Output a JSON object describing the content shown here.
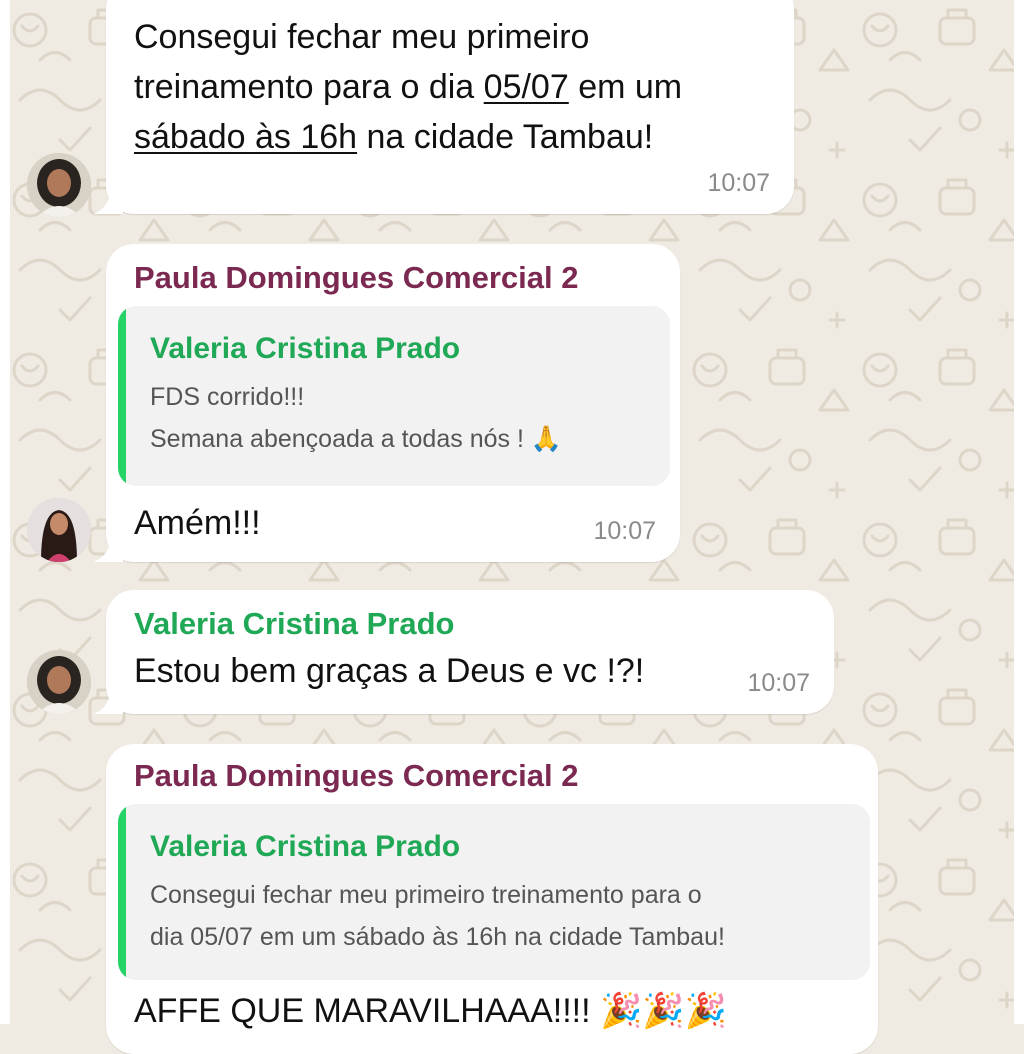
{
  "colors": {
    "chat_background": "#efeae2",
    "bubble": "#ffffff",
    "sender_paula": "#7b2951",
    "sender_valeria": "#1fa855",
    "quote_bar": "#25d366"
  },
  "messages": [
    {
      "line1": "Consegui fechar meu primeiro",
      "line2_pre": "treinamento para o dia ",
      "line2_link": "05/07",
      "line2_post": " em um",
      "line3_link": "sábado às 16h",
      "line3_post": " na cidade Tambau!",
      "time": "10:07"
    },
    {
      "sender": "Paula Domingues Comercial 2",
      "quote": {
        "author": "Valeria Cristina Prado",
        "line1": "FDS corrido!!!",
        "line2": "Semana abençoada a todas nós ! 🙏"
      },
      "text": "Amém!!!",
      "time": "10:07"
    },
    {
      "sender": "Valeria Cristina Prado",
      "text": "Estou bem graças a Deus e vc !?!",
      "time": "10:07"
    },
    {
      "sender": "Paula Domingues Comercial 2",
      "quote": {
        "author": "Valeria Cristina Prado",
        "line1": "Consegui fechar meu primeiro treinamento para o",
        "line2": "dia 05/07 em um sábado às 16h na cidade Tambau!"
      },
      "text": "AFFE QUE MARAVILHAAA!!!! 🎉🎉🎉"
    }
  ],
  "icons": {
    "avatar_valeria": "avatar-photo",
    "avatar_paula": "avatar-photo",
    "wallpaper": "doodle-pattern"
  }
}
